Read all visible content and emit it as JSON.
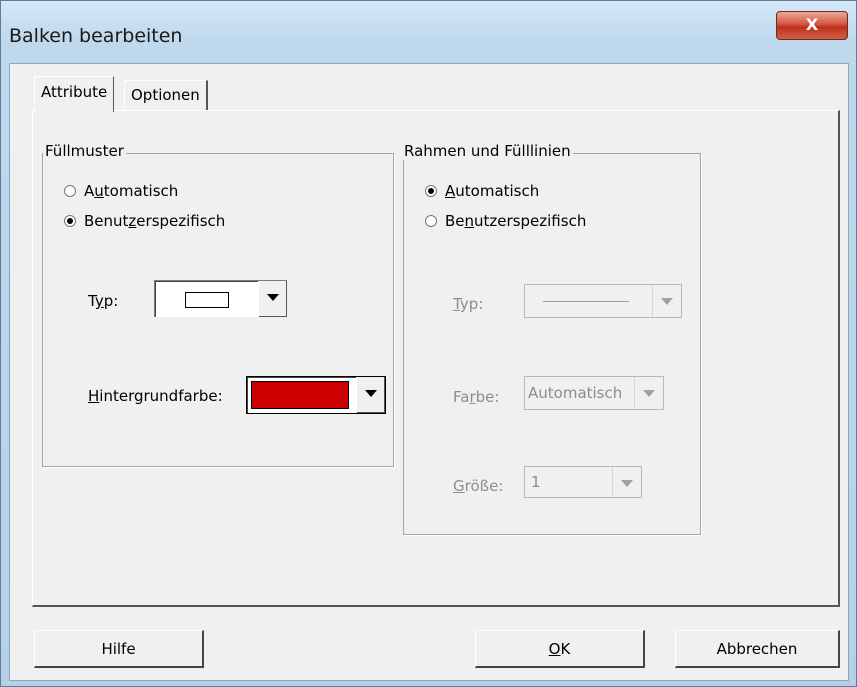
{
  "window": {
    "title": "Balken bearbeiten",
    "close_glyph": "X"
  },
  "tabs": [
    {
      "label": "Attribute"
    },
    {
      "label": "Optionen"
    }
  ],
  "fill": {
    "legend": "Füllmuster",
    "auto": {
      "pre": "A",
      "u": "u",
      "post": "tomatisch"
    },
    "custom": {
      "pre": "Benut",
      "u": "z",
      "post": "erspezifisch"
    },
    "type": {
      "pre": "T",
      "u": "y",
      "post": "p:"
    },
    "bgcolor": {
      "pre": "",
      "u": "H",
      "post": "intergrundfarbe:"
    },
    "bgcolor_value": "#cc0000"
  },
  "border": {
    "legend": "Rahmen und Fülllinien",
    "auto": {
      "pre": "",
      "u": "A",
      "post": "utomatisch"
    },
    "custom": {
      "pre": "Be",
      "u": "n",
      "post": "utzerspezifisch"
    },
    "type": {
      "pre": "",
      "u": "T",
      "post": "yp:"
    },
    "color": {
      "pre": "Fa",
      "u": "r",
      "post": "be:"
    },
    "color_value": "Automatisch",
    "size": {
      "pre": "",
      "u": "G",
      "post": "röße:"
    },
    "size_value": "1"
  },
  "buttons": {
    "help": "Hilfe",
    "ok": {
      "u": "O",
      "post": "K"
    },
    "cancel": "Abbrechen"
  }
}
